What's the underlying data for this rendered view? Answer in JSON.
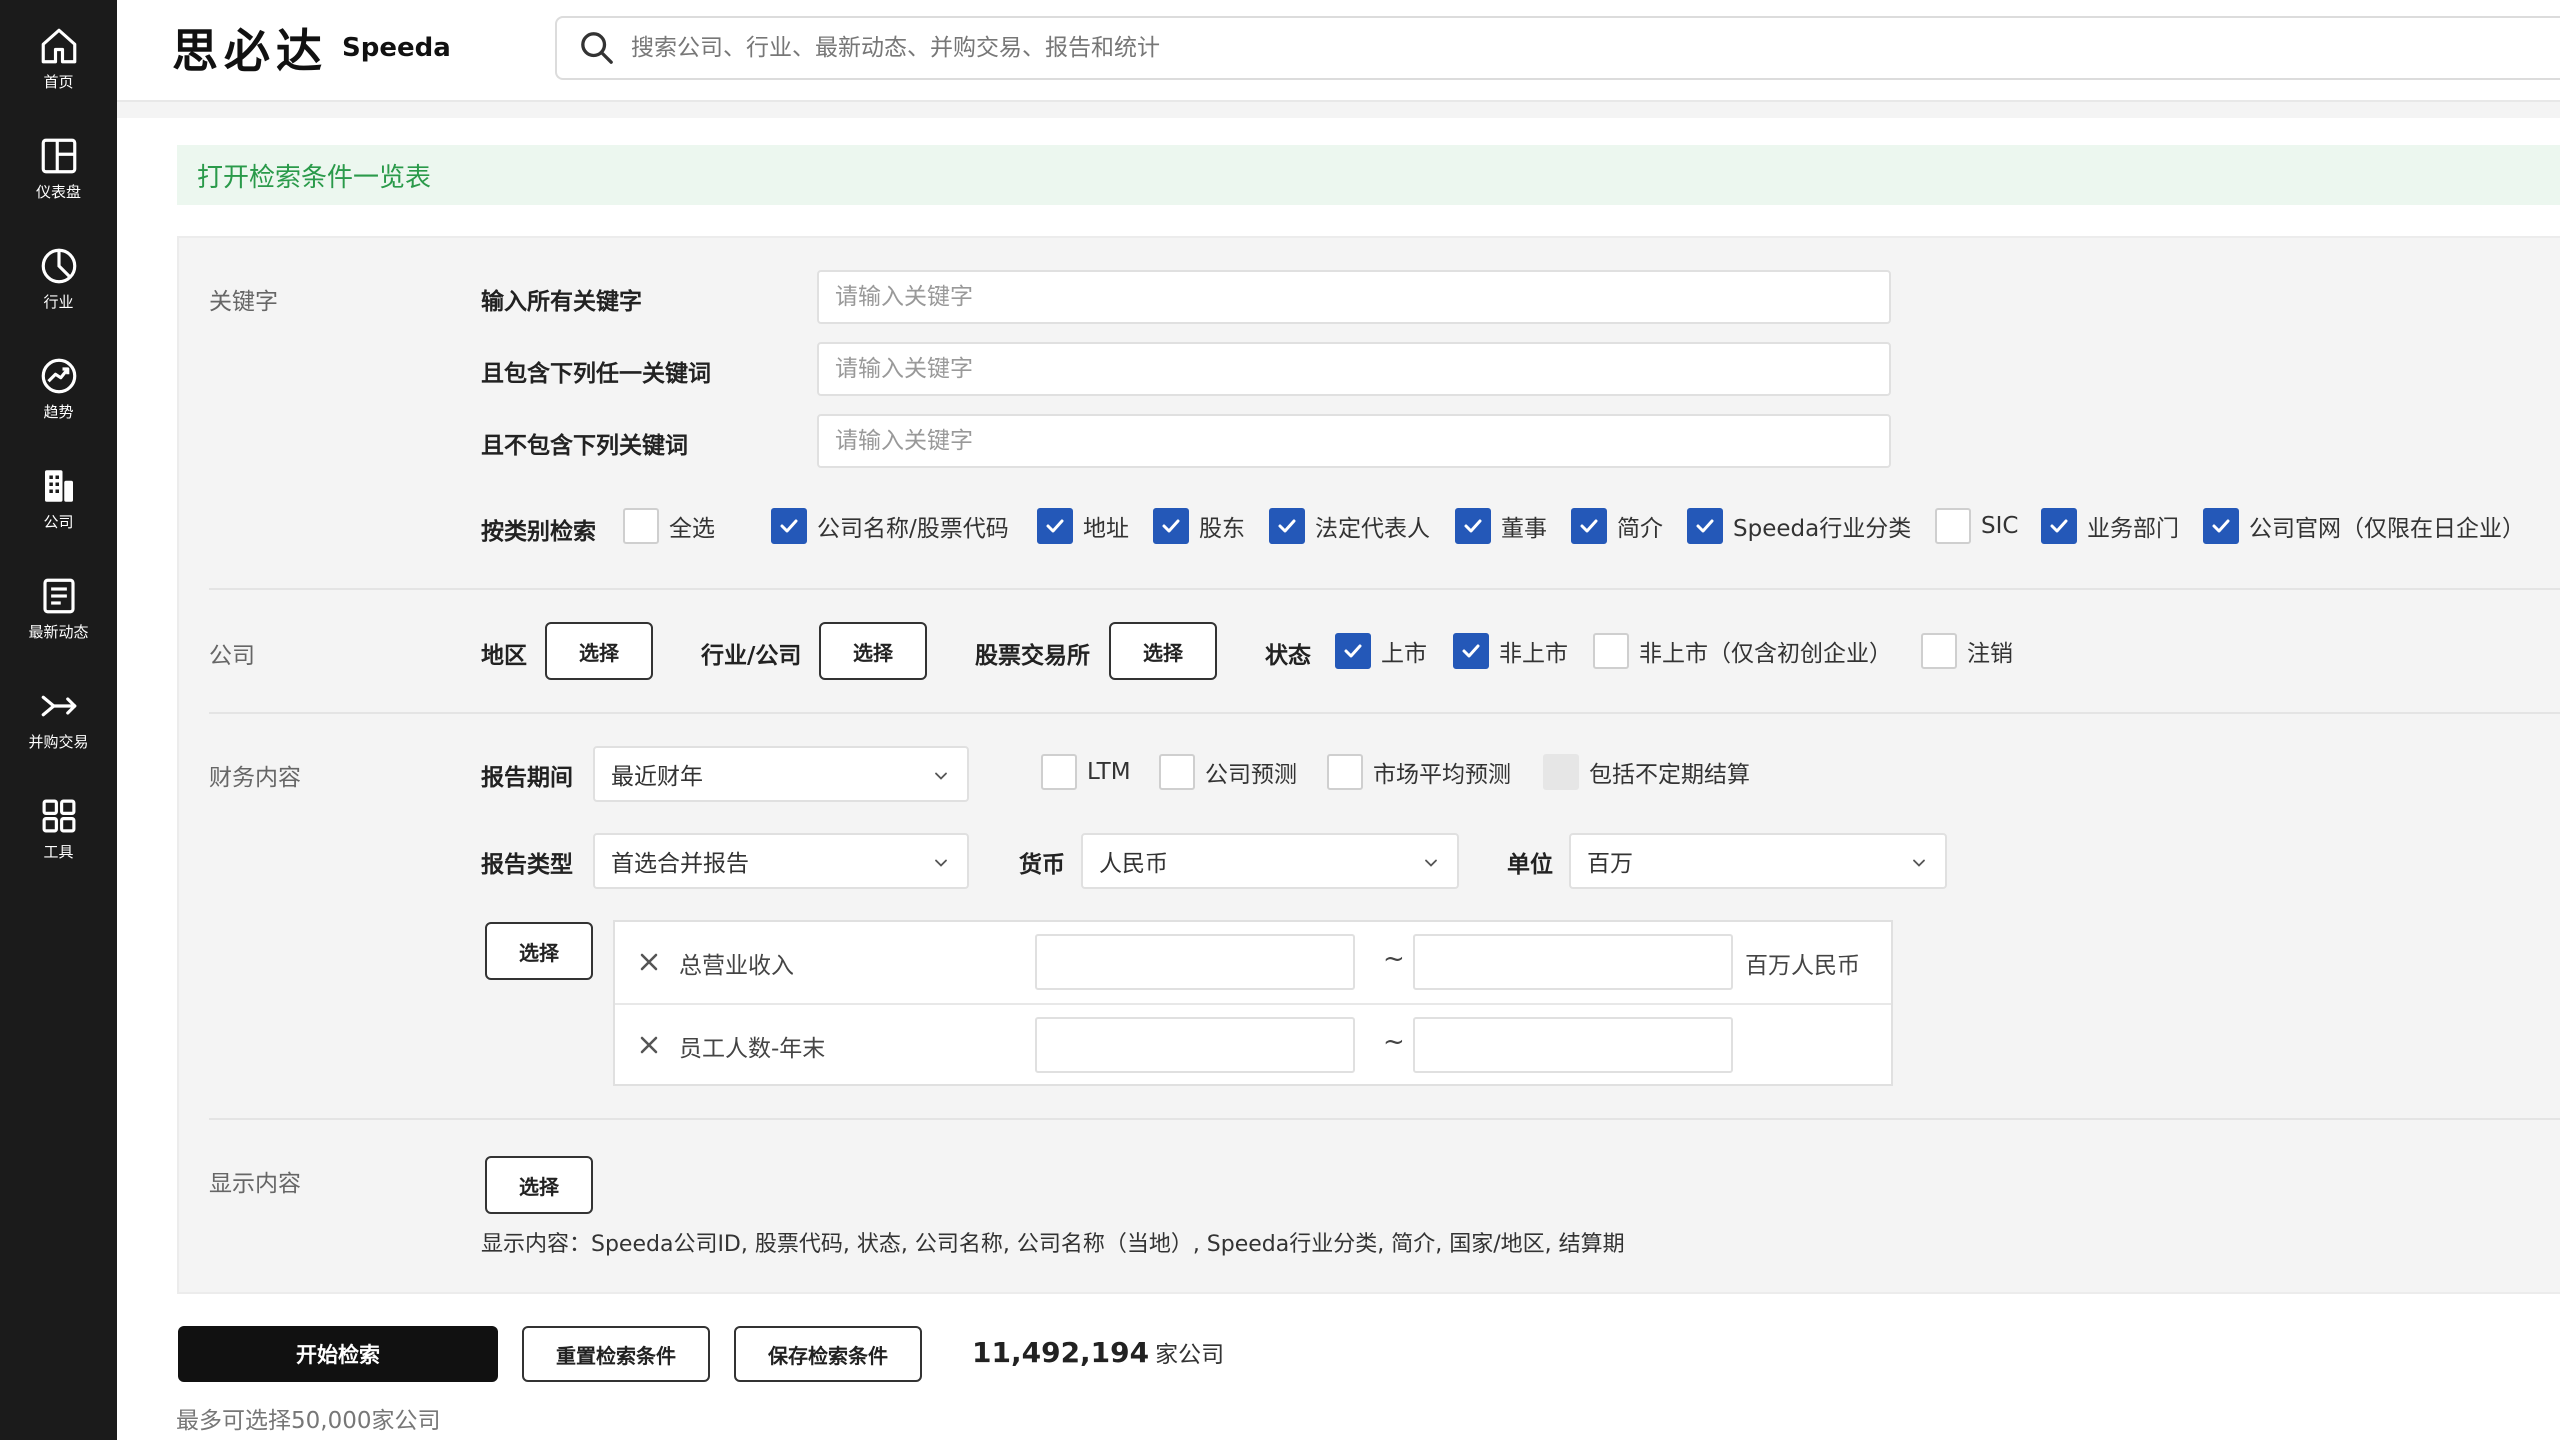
{
  "nav": {
    "items": [
      {
        "label": "首页",
        "icon": "home-icon"
      },
      {
        "label": "仪表盘",
        "icon": "dashboard-icon"
      },
      {
        "label": "行业",
        "icon": "industry-pie-icon"
      },
      {
        "label": "趋势",
        "icon": "trend-icon"
      },
      {
        "label": "公司",
        "icon": "company-building-icon"
      },
      {
        "label": "最新动态",
        "icon": "news-icon"
      },
      {
        "label": "并购交易",
        "icon": "ma-deal-icon"
      },
      {
        "label": "工具",
        "icon": "tools-grid-icon"
      }
    ]
  },
  "header": {
    "logo_cn": "思必达",
    "logo_en": "Speeda",
    "search_placeholder": "搜索公司、行业、最新动态、并购交易、报告和统计"
  },
  "banner": {
    "text": "打开检索条件一览表"
  },
  "keywords": {
    "section_label": "关键字",
    "all_label": "输入所有关键字",
    "any_label": "且包含下列任一关键词",
    "none_label": "且不包含下列关键词",
    "placeholder": "请输入关键字",
    "category_label": "按类别检索",
    "categories": [
      {
        "label": "全选",
        "checked": false
      },
      {
        "label": "公司名称/股票代码",
        "checked": true
      },
      {
        "label": "地址",
        "checked": true
      },
      {
        "label": "股东",
        "checked": true
      },
      {
        "label": "法定代表人",
        "checked": true
      },
      {
        "label": "董事",
        "checked": true
      },
      {
        "label": "简介",
        "checked": true
      },
      {
        "label": "Speeda行业分类",
        "checked": true
      },
      {
        "label": "SIC",
        "checked": false
      },
      {
        "label": "业务部门",
        "checked": true
      },
      {
        "label": "公司官网（仅限在日企业）",
        "checked": true
      }
    ]
  },
  "company": {
    "section_label": "公司",
    "region_label": "地区",
    "industry_label": "行业/公司",
    "exchange_label": "股票交易所",
    "status_label": "状态",
    "select_label": "选择",
    "statuses": [
      {
        "label": "上市",
        "checked": true
      },
      {
        "label": "非上市",
        "checked": true
      },
      {
        "label": "非上市（仅含初创企业）",
        "checked": false
      },
      {
        "label": "注销",
        "checked": false
      }
    ]
  },
  "financial": {
    "section_label": "财务内容",
    "period_label": "报告期间",
    "period_value": "最近财年",
    "period_options": [
      {
        "label": "LTM",
        "checked": false,
        "disabled": false
      },
      {
        "label": "公司预测",
        "checked": false,
        "disabled": false
      },
      {
        "label": "市场平均预测",
        "checked": false,
        "disabled": false
      },
      {
        "label": "包括不定期结算",
        "checked": false,
        "disabled": true
      }
    ],
    "report_type_label": "报告类型",
    "report_type_value": "首选合并报告",
    "currency_label": "货币",
    "currency_value": "人民币",
    "unit_label": "单位",
    "unit_value": "百万",
    "select_label": "选择",
    "ranges": [
      {
        "name": "总营业收入",
        "from": "",
        "to": "",
        "unit": "百万人民币"
      },
      {
        "name": "员工人数-年末",
        "from": "",
        "to": "",
        "unit": ""
      }
    ],
    "range_sep": "~"
  },
  "display": {
    "section_label": "显示内容",
    "select_label": "选择",
    "text": "显示内容：Speeda公司ID, 股票代码, 状态, 公司名称, 公司名称（当地）, Speeda行业分类, 简介, 国家/地区, 结算期"
  },
  "actions": {
    "start": "开始检索",
    "reset": "重置检索条件",
    "save": "保存检索条件",
    "count_value": "11,492,194",
    "count_unit": "家公司",
    "max_note": "最多可选择50,000家公司"
  },
  "colors": {
    "sidebar_bg": "#1b1b1b",
    "checkbox_accent": "#2458b8",
    "banner_bg": "#ecf7ef",
    "banner_text": "#2a9a4a"
  }
}
